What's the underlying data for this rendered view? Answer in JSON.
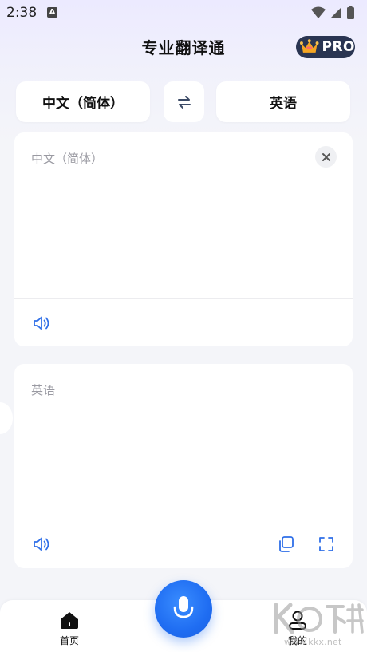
{
  "status_bar": {
    "time": "2:38",
    "notification_icon_letter": "A",
    "icons": [
      "wifi-icon",
      "cell-signal-icon",
      "battery-icon"
    ]
  },
  "header": {
    "title": "专业翻译通",
    "pro_label": "PRO"
  },
  "languages": {
    "source": "中文（简体）",
    "target": "英语",
    "swap_icon": "swap-arrows-icon"
  },
  "input_panel": {
    "language_label": "中文（简体）",
    "clear_icon": "close-icon",
    "speaker_icon": "speaker-icon"
  },
  "output_panel": {
    "language_label": "英语",
    "speaker_icon": "speaker-icon",
    "copy_icon": "copy-icon",
    "fullscreen_icon": "fullscreen-icon"
  },
  "bottom_nav": {
    "home_label": "首页",
    "mine_label": "我的",
    "mic_icon": "microphone-icon"
  },
  "watermark": {
    "text": "www.kkx.net"
  },
  "colors": {
    "accent_blue": "#1f6df2",
    "pro_badge_bg": "#2a3552",
    "icon_blue": "#2f6fe8"
  }
}
